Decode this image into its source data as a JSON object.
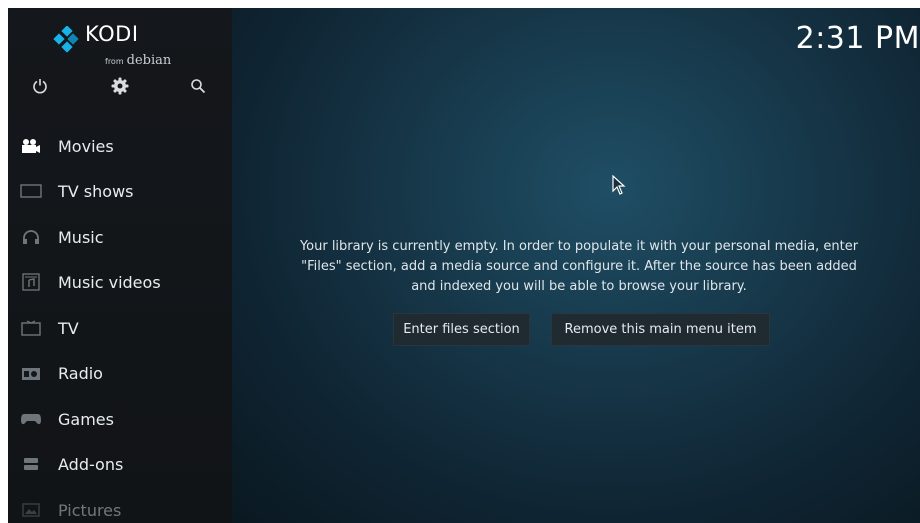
{
  "app": {
    "name": "KODI",
    "from_label": "from",
    "distro": "debian"
  },
  "top_icons": [
    "power-icon",
    "settings-icon",
    "search-icon"
  ],
  "clock": "2:31 PM",
  "sidebar": {
    "items": [
      {
        "label": "Movies",
        "icon": "movies-icon"
      },
      {
        "label": "TV shows",
        "icon": "tv-shows-icon"
      },
      {
        "label": "Music",
        "icon": "headphones-icon"
      },
      {
        "label": "Music videos",
        "icon": "music-videos-icon"
      },
      {
        "label": "TV",
        "icon": "tv-icon"
      },
      {
        "label": "Radio",
        "icon": "radio-icon"
      },
      {
        "label": "Games",
        "icon": "gamepad-icon"
      },
      {
        "label": "Add-ons",
        "icon": "addons-icon"
      },
      {
        "label": "Pictures",
        "icon": "pictures-icon"
      }
    ]
  },
  "main": {
    "message_lines": [
      "Your library is currently empty. In order to populate it with your personal media, enter",
      "\"Files\" section, add a media source and configure it. After the source has been added",
      "and indexed you will be able to browse your library."
    ],
    "buttons": {
      "enter_files": "Enter files section",
      "remove_item": "Remove this main menu item"
    }
  },
  "colors": {
    "kodi_blue": "#17b2e8",
    "sidebar_bg": "#14171b",
    "main_bg": "#17394b",
    "button_bg": "#1f2a31"
  }
}
